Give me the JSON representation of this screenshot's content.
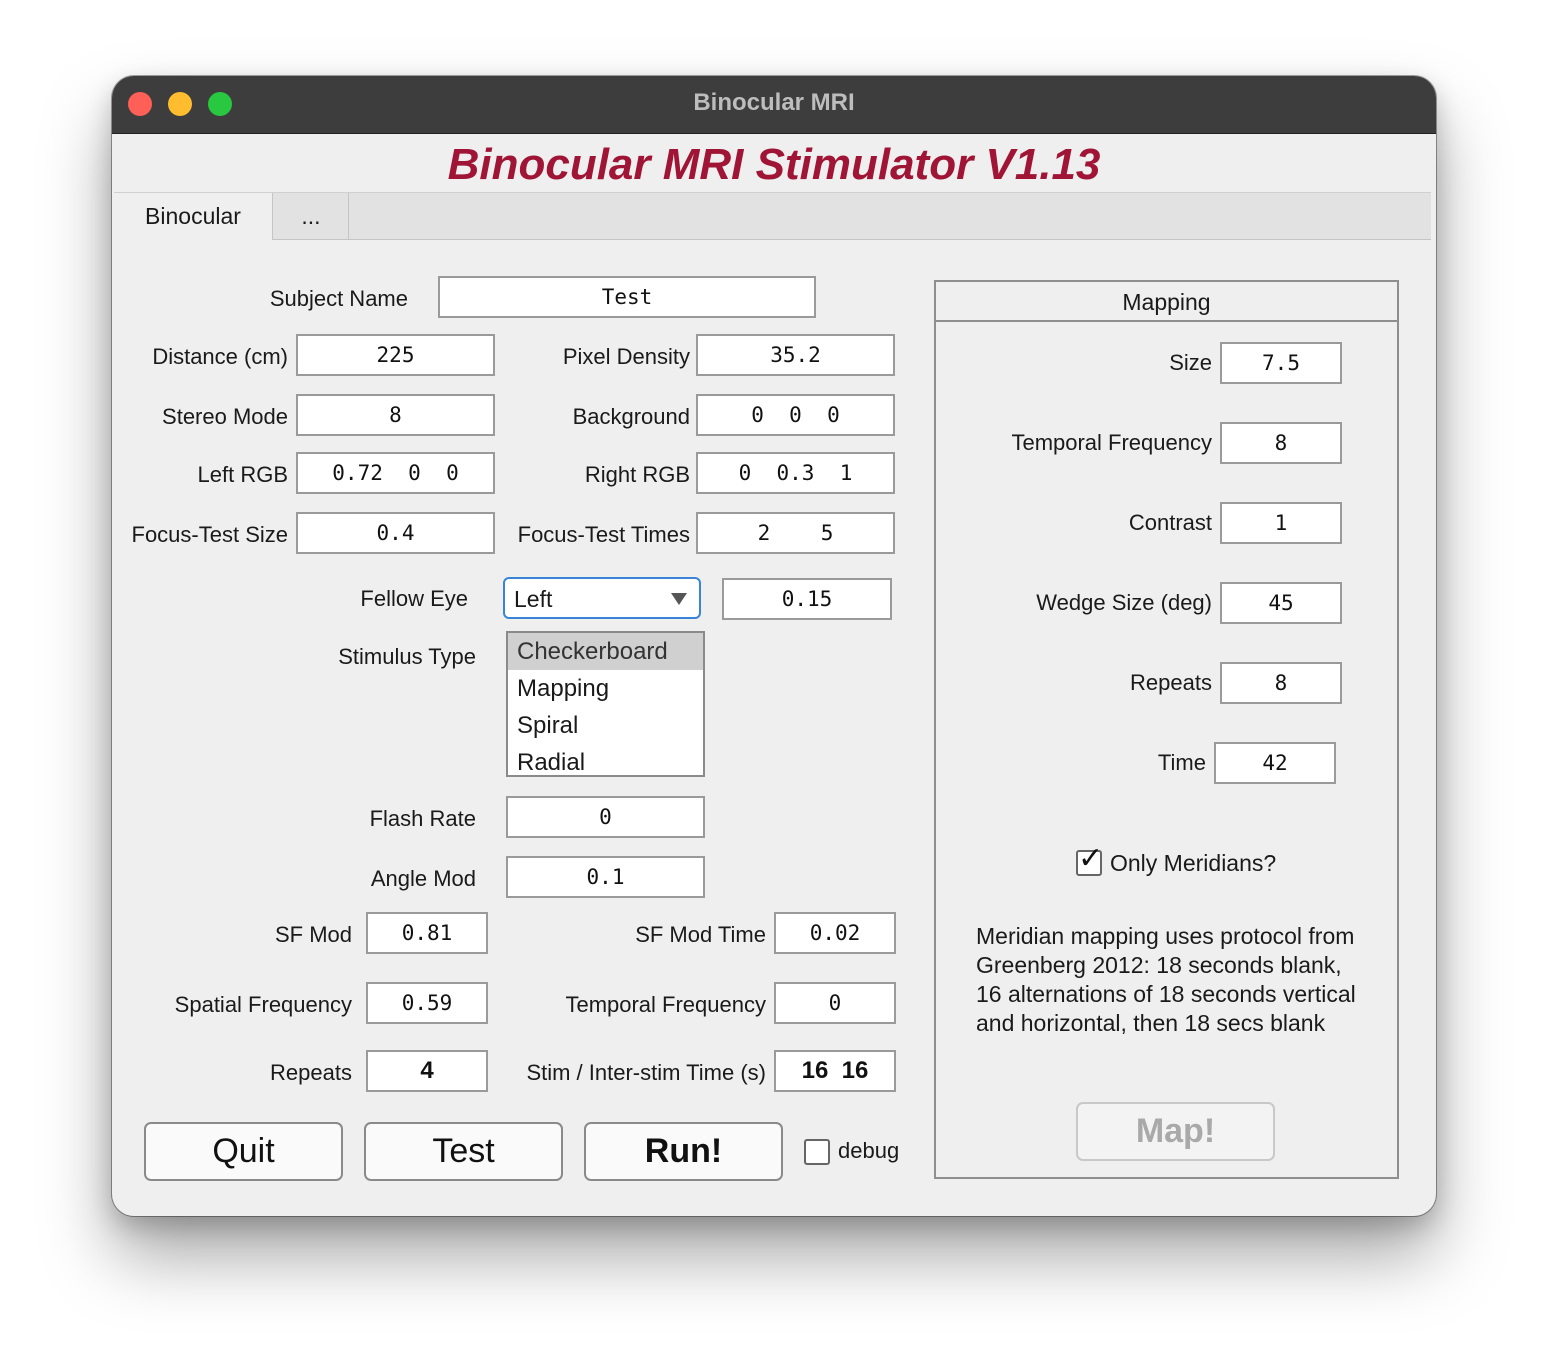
{
  "window": {
    "title": "Binocular MRI"
  },
  "app": {
    "title": "Binocular MRI Stimulator V1.13"
  },
  "tabs": [
    {
      "label": "Binocular"
    },
    {
      "label": "..."
    }
  ],
  "form": {
    "subject_name": {
      "label": "Subject Name",
      "value": "Test"
    },
    "distance": {
      "label": "Distance (cm)",
      "value": "225"
    },
    "pixel_density": {
      "label": "Pixel Density",
      "value": "35.2"
    },
    "stereo_mode": {
      "label": "Stereo Mode",
      "value": "8"
    },
    "background": {
      "label": "Background",
      "value": "0  0  0"
    },
    "left_rgb": {
      "label": "Left RGB",
      "value": "0.72  0  0"
    },
    "right_rgb": {
      "label": "Right RGB",
      "value": "0  0.3  1"
    },
    "focus_test_size": {
      "label": "Focus-Test Size",
      "value": "0.4"
    },
    "focus_test_times": {
      "label": "Focus-Test Times",
      "value": "2    5"
    },
    "fellow_eye": {
      "label": "Fellow Eye",
      "selected": "Left",
      "value": "0.15"
    },
    "stimulus_type": {
      "label": "Stimulus Type",
      "options": [
        "Checkerboard",
        "Mapping",
        "Spiral",
        "Radial"
      ],
      "selected": "Checkerboard"
    },
    "flash_rate": {
      "label": "Flash Rate",
      "value": "0"
    },
    "angle_mod": {
      "label": "Angle Mod",
      "value": "0.1"
    },
    "sf_mod": {
      "label": "SF Mod",
      "value": "0.81"
    },
    "sf_mod_time": {
      "label": "SF Mod Time",
      "value": "0.02"
    },
    "spatial_frequency": {
      "label": "Spatial Frequency",
      "value": "0.59"
    },
    "temporal_frequency": {
      "label": "Temporal Frequency",
      "value": "0"
    },
    "repeats": {
      "label": "Repeats",
      "value": "4"
    },
    "stim_time": {
      "label": "Stim / Inter-stim Time (s)",
      "value": "16  16"
    }
  },
  "buttons": {
    "quit": "Quit",
    "test": "Test",
    "run": "Run!"
  },
  "debug": {
    "label": "debug",
    "checked": false
  },
  "mapping": {
    "title": "Mapping",
    "size": {
      "label": "Size",
      "value": "7.5"
    },
    "temporal_frequency": {
      "label": "Temporal Frequency",
      "value": "8"
    },
    "contrast": {
      "label": "Contrast",
      "value": "1"
    },
    "wedge_size": {
      "label": "Wedge Size (deg)",
      "value": "45"
    },
    "repeats": {
      "label": "Repeats",
      "value": "8"
    },
    "time": {
      "label": "Time",
      "value": "42"
    },
    "only_meridians": {
      "label": "Only Meridians?",
      "checked": true
    },
    "description": "Meridian mapping uses protocol from Greenberg 2012: 18 seconds blank, 16 alternations of 18 seconds vertical and horizontal, then 18 secs blank",
    "map_button": "Map!"
  },
  "colors": {
    "accent_title": "#a01535",
    "focus_ring": "#3a84d6"
  },
  "icons": [
    "close-icon",
    "minimize-icon",
    "maximize-icon",
    "chevron-down-icon",
    "checkmark-icon"
  ]
}
